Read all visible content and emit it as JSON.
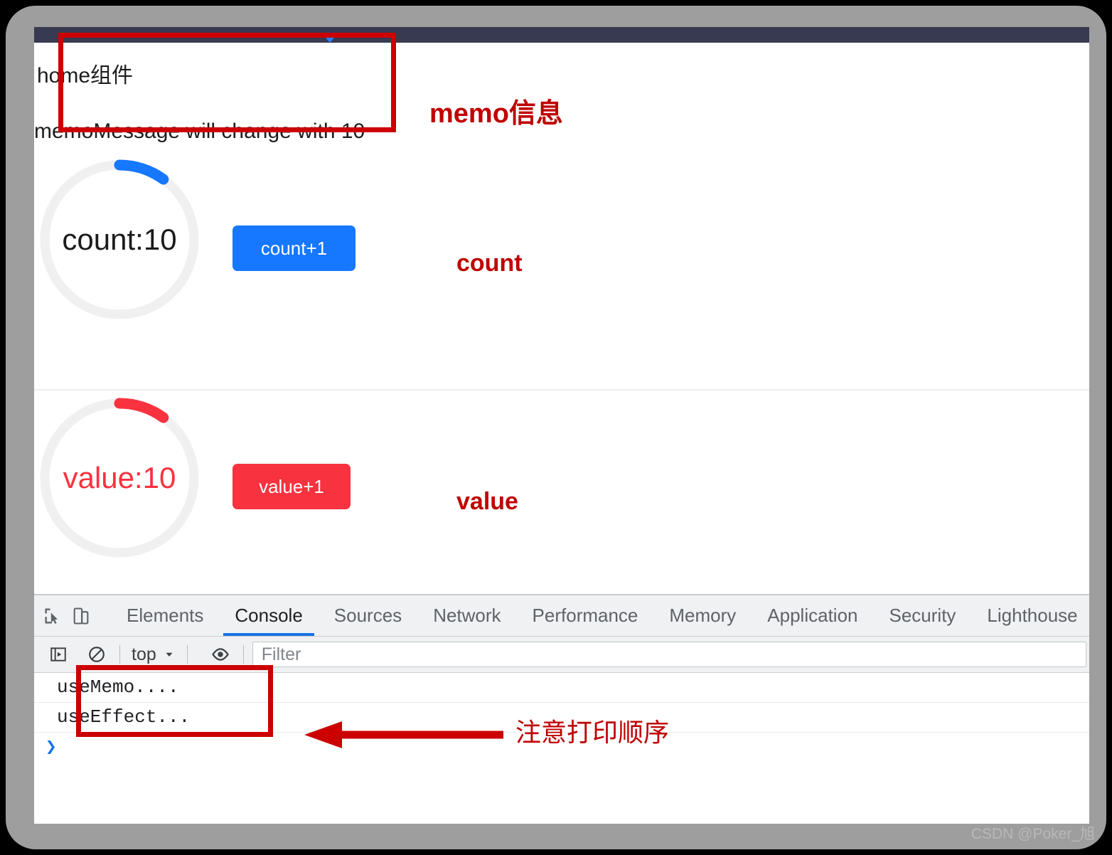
{
  "page": {
    "memo": {
      "line1": "home组件",
      "line2": "memoMessage will change with 10"
    },
    "count_section": {
      "ring_label": "count:10",
      "button_label": "count+1",
      "progress_percent": 10,
      "accent_color": "#1677ff",
      "track_color": "#f0f0f0"
    },
    "value_section": {
      "ring_label": "value:10",
      "button_label": "value+1",
      "progress_percent": 10,
      "accent_color": "#f8323f",
      "track_color": "#f0f0f0"
    }
  },
  "annotations": {
    "memo_label": "memo信息",
    "count_label": "count",
    "value_label": "value",
    "console_order_label": "注意打印顺序",
    "color": "#c00000",
    "box_color": "#cc0000"
  },
  "devtools": {
    "icons": {
      "inspect": "inspect-element-icon",
      "device": "device-toolbar-icon",
      "sidebar": "console-sidebar-icon",
      "clear": "clear-console-icon",
      "eye": "live-expression-icon",
      "chevron": "chevron-down-icon"
    },
    "tabs": [
      {
        "label": "Elements",
        "active": false
      },
      {
        "label": "Console",
        "active": true
      },
      {
        "label": "Sources",
        "active": false
      },
      {
        "label": "Network",
        "active": false
      },
      {
        "label": "Performance",
        "active": false
      },
      {
        "label": "Memory",
        "active": false
      },
      {
        "label": "Application",
        "active": false
      },
      {
        "label": "Security",
        "active": false
      },
      {
        "label": "Lighthouse",
        "active": false
      }
    ],
    "filterbar": {
      "context": "top",
      "filter_placeholder": "Filter",
      "filter_value": ""
    },
    "console_messages": [
      "useMemo....",
      "useEffect..."
    ],
    "prompt_symbol": "❯"
  },
  "watermark": "CSDN @Poker_旭"
}
